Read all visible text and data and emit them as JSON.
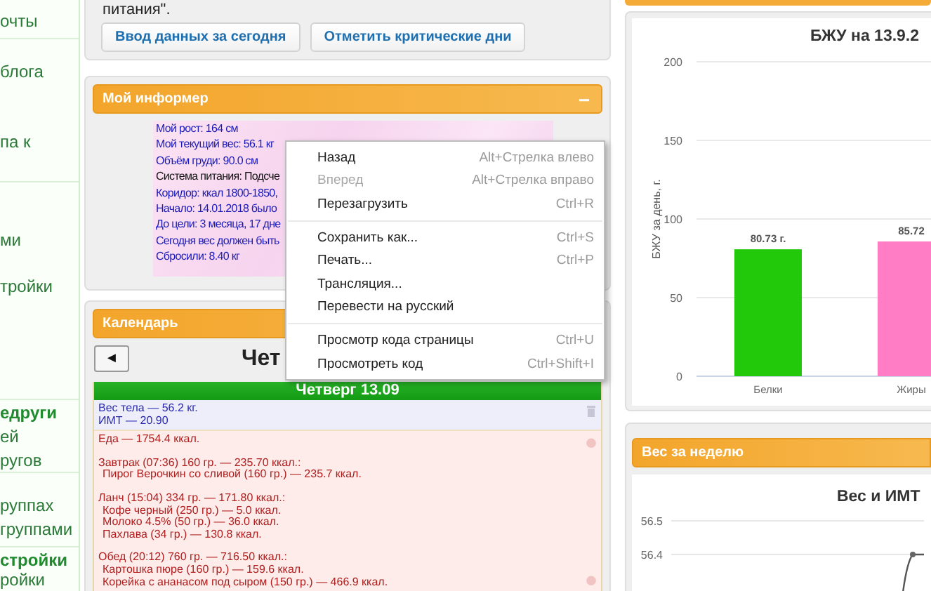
{
  "sidebar": {
    "groups": [
      {
        "items": [
          {
            "kind": "link",
            "label": "очты"
          }
        ]
      },
      {
        "items": [
          {
            "kind": "link",
            "label": "блога"
          },
          {
            "kind": "link",
            "label": "па к"
          }
        ]
      },
      {
        "items": [
          {
            "kind": "link",
            "label": "ми"
          },
          {
            "kind": "link",
            "label": "тройки"
          }
        ]
      },
      {
        "items": [
          {
            "kind": "heading",
            "label": "едруги"
          },
          {
            "kind": "link",
            "label": "ей"
          },
          {
            "kind": "link",
            "label": "ругов"
          }
        ]
      },
      {
        "items": [
          {
            "kind": "link",
            "label": "руппах"
          },
          {
            "kind": "link",
            "label": "группами"
          }
        ]
      },
      {
        "items": [
          {
            "kind": "heading",
            "label": "стройки"
          },
          {
            "kind": "link",
            "label": "ройки"
          }
        ]
      }
    ]
  },
  "intro": {
    "text": "питания\".",
    "buttons": [
      "Ввод данных за сегодня",
      "Отметить критические дни"
    ]
  },
  "informer": {
    "title": "Мой информер",
    "collapse": "−",
    "lines": [
      {
        "kind": "metric",
        "text": "Мой рост: 164 см"
      },
      {
        "kind": "metric",
        "text": "Мой текущий вес: 56.1 кг"
      },
      {
        "kind": "metric",
        "text": "Объём груди: 90.0 см"
      },
      {
        "kind": "plain",
        "text": "Система питания: Подсче"
      },
      {
        "kind": "metric",
        "text": "Коридор: ккал 1800-1850,"
      },
      {
        "kind": "metric",
        "text": "Начало: 14.01.2018 было"
      },
      {
        "kind": "metric",
        "text": "До цели: 3 месяца, 17 дне"
      },
      {
        "kind": "metric",
        "text": "Сегодня вес должен быть"
      },
      {
        "kind": "metric",
        "text": "Сбросили: 8.40 кг"
      }
    ]
  },
  "calendar": {
    "title": "Календарь",
    "prev": "◄",
    "date_title": "Чет",
    "day_header": "Четверг 13.09",
    "weight": [
      "Вес тела — 56.2 кг.",
      "ИМТ — 20.90"
    ],
    "food_total": "Еда — 1754.4 ккал.",
    "meals": [
      {
        "title": "Завтрак (07:36) 160 гр. — 235.70 ккал.:",
        "items": [
          "Пирог Верочкин со сливой (160 гр.) — 235.7 ккал."
        ]
      },
      {
        "title": "Ланч (15:04) 334 гр. — 171.80 ккал.:",
        "items": [
          "Кофе черный (250 гр.) — 5.0 ккал.",
          "Молоко 4.5% (50 гр.) — 36.0 ккал.",
          "Пахлава (34 гр.) — 130.8 ккал."
        ]
      },
      {
        "title": "Обед (20:12) 760 гр. — 716.50 ккал.:",
        "items": [
          "Картошка пюре (160 гр.) — 159.6 ккал.",
          "Корейка с ананасом под сыром (150 гр.) — 466.9 ккал."
        ]
      }
    ]
  },
  "macros": {
    "chart_data": {
      "type": "bar",
      "title": "БЖУ на 13.9.2",
      "ylabel": "БЖУ за день, г.",
      "categories": [
        "Белки",
        "Жиры"
      ],
      "values": [
        80.73,
        85.72
      ],
      "ylim": [
        0,
        200
      ],
      "yticks": [
        0,
        50,
        100,
        150,
        200
      ],
      "value_labels": [
        "80.73 г.",
        "85.72"
      ],
      "grid": true
    }
  },
  "weight_week": {
    "title": "Вес за неделю",
    "chart": {
      "title": "Вес и ИМТ",
      "yticks": [
        "56.5",
        "56.4"
      ]
    }
  },
  "context_menu": {
    "sections": [
      [
        {
          "label": "Назад",
          "shortcut": "Alt+Стрелка влево",
          "disabled": false
        },
        {
          "label": "Вперед",
          "shortcut": "Alt+Стрелка вправо",
          "disabled": true
        },
        {
          "label": "Перезагрузить",
          "shortcut": "Ctrl+R",
          "disabled": false
        }
      ],
      [
        {
          "label": "Сохранить как...",
          "shortcut": "Ctrl+S",
          "disabled": false
        },
        {
          "label": "Печать...",
          "shortcut": "Ctrl+P",
          "disabled": false
        },
        {
          "label": "Трансляция...",
          "disabled": false
        },
        {
          "label": "Перевести на русский",
          "disabled": false
        }
      ],
      [
        {
          "label": "Просмотр кода страницы",
          "shortcut": "Ctrl+U",
          "disabled": false
        },
        {
          "label": "Просмотреть код",
          "shortcut": "Ctrl+Shift+I",
          "disabled": false
        }
      ]
    ]
  }
}
